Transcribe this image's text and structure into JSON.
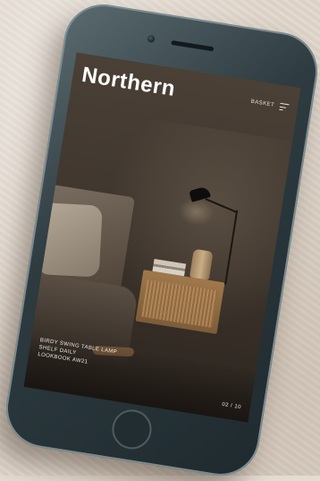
{
  "app": {
    "logo": "Northern",
    "basket_label": "BASKET"
  },
  "hero": {
    "caption_lines": [
      "BIRDY SWING TABLE LAMP",
      "SHELF DAILY",
      "LOOKBOOK AW21"
    ],
    "pagination": "02 / 10"
  },
  "icons": {
    "menu": "menu-icon",
    "home": "home-button"
  },
  "colors": {
    "background": "#e2d8cd",
    "phone_body": "#2e3b40",
    "screen_dark": "#3f362e",
    "logo_text": "#ffffff"
  }
}
